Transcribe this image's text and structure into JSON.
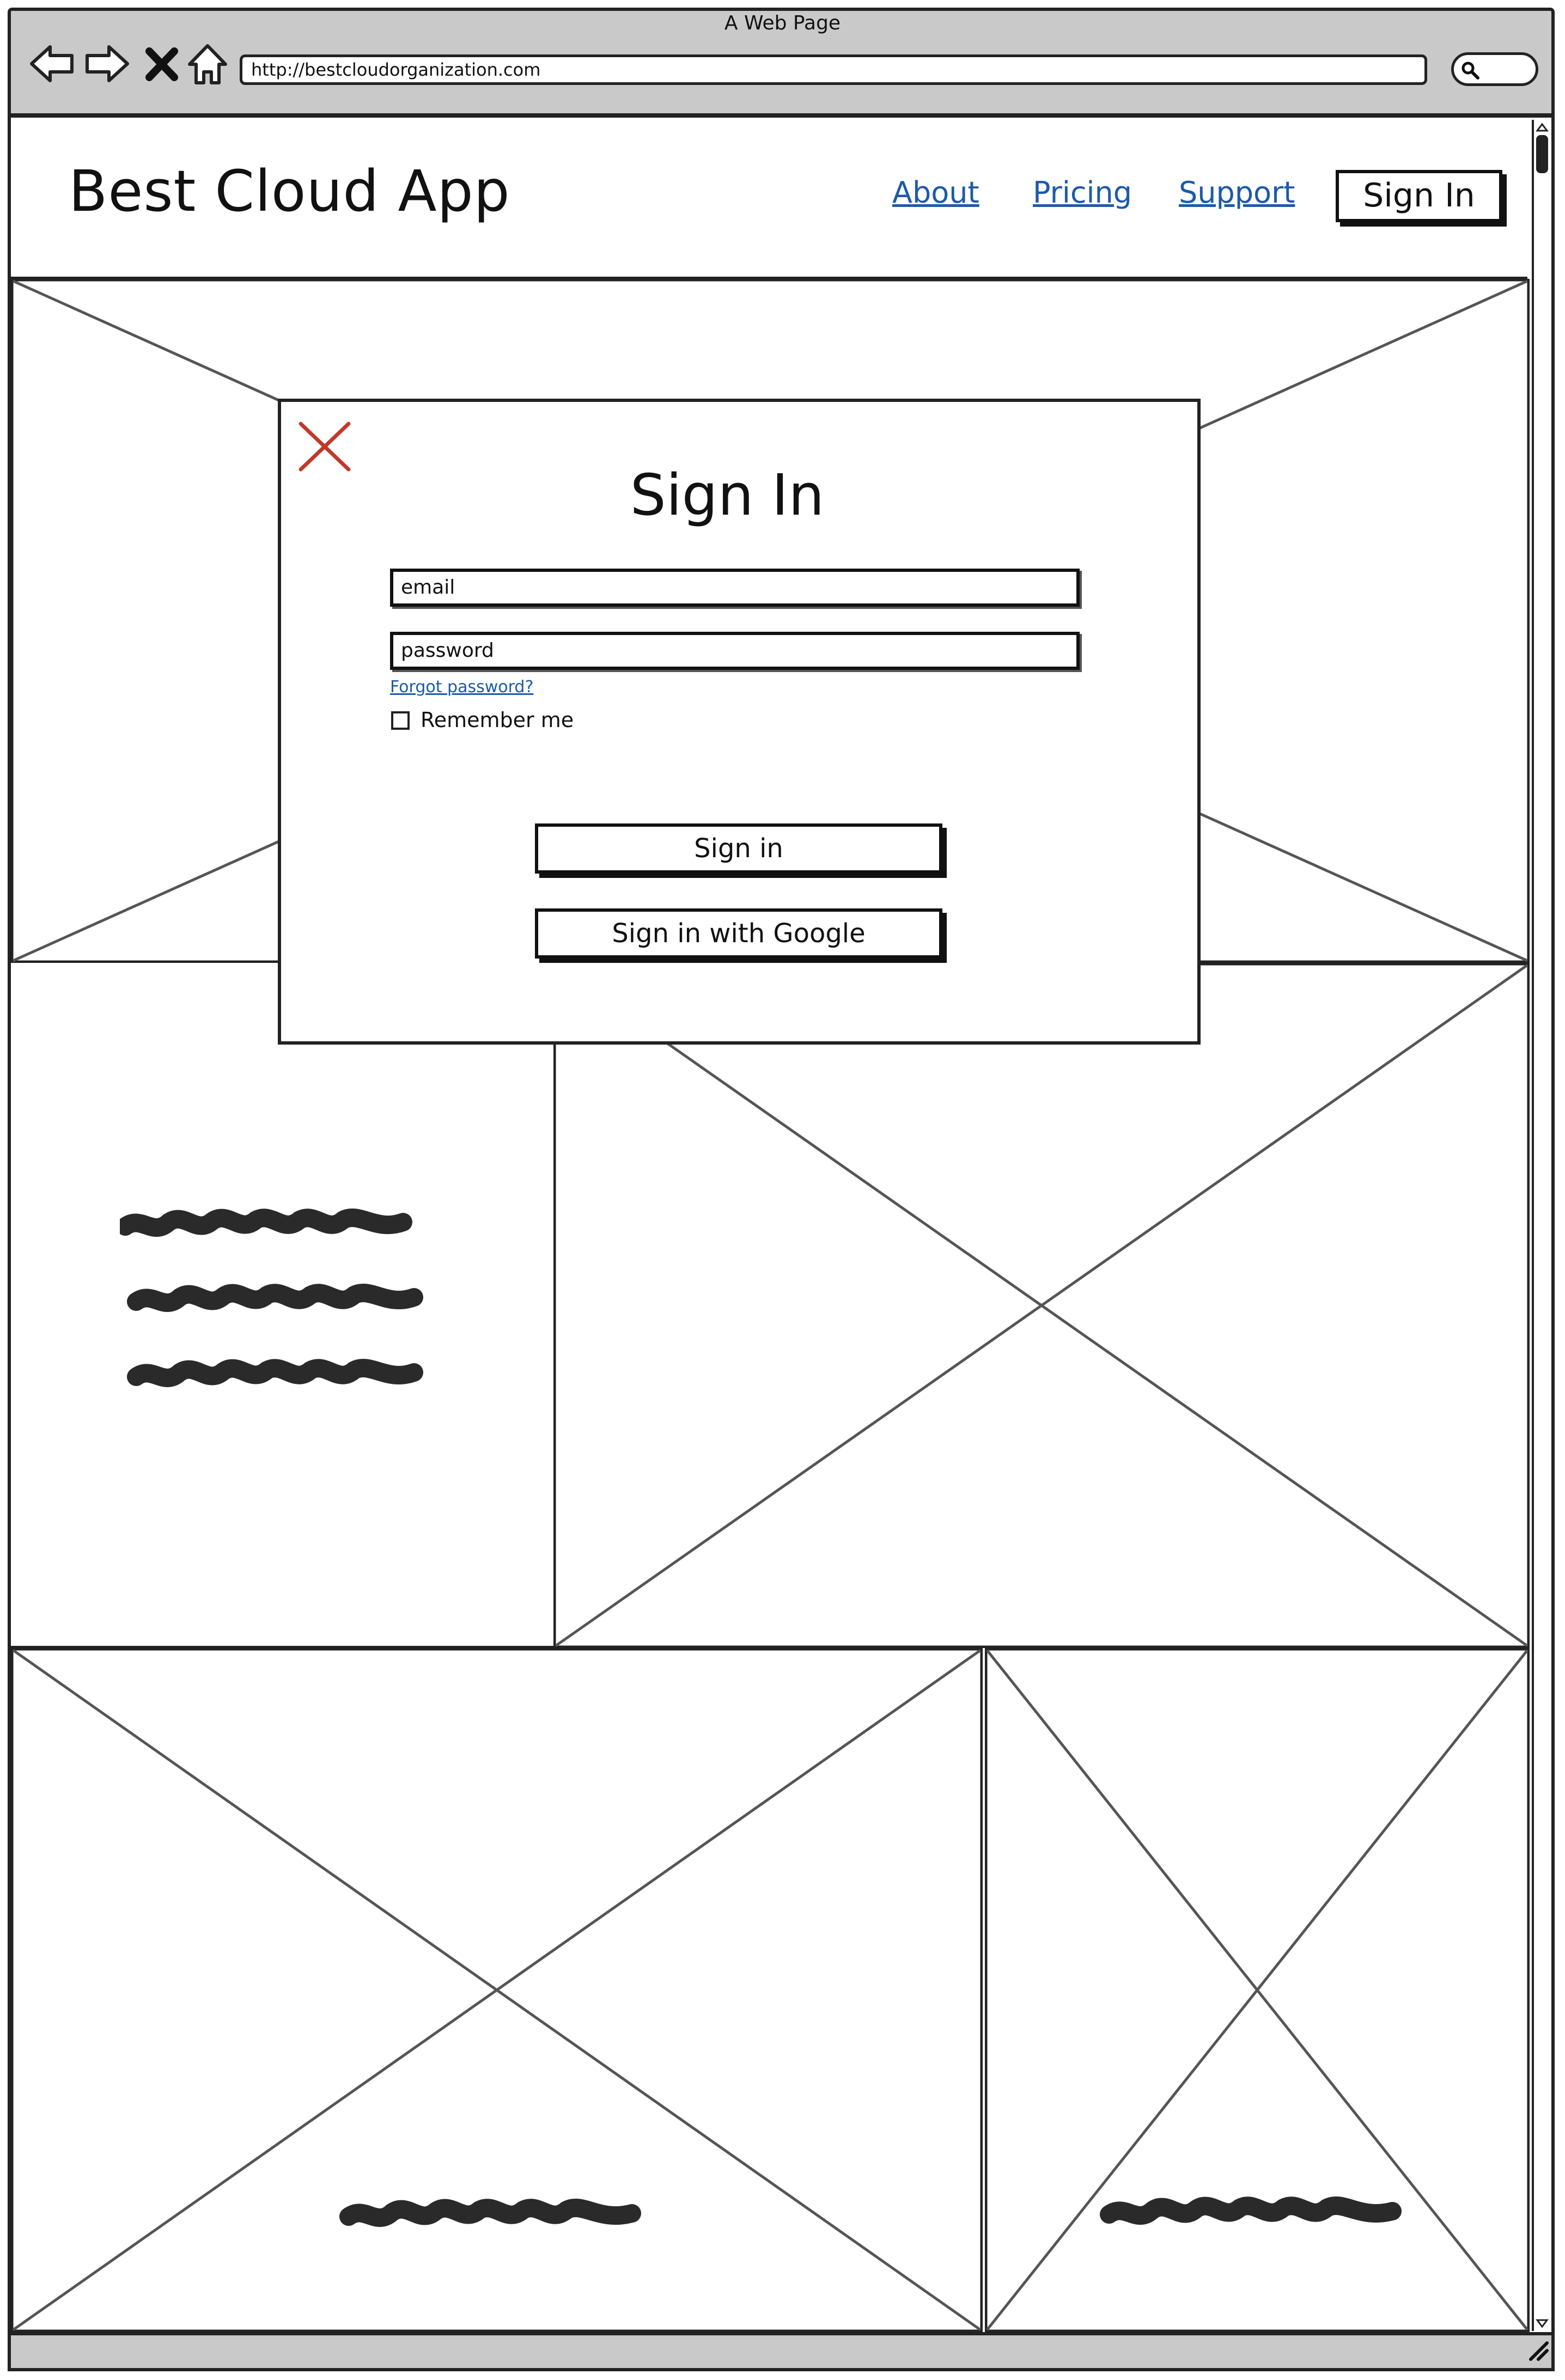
{
  "browser": {
    "window_title": "A Web Page",
    "url": "http://bestcloudorganization.com"
  },
  "header": {
    "site_title": "Best Cloud App",
    "nav": [
      "About",
      "Pricing",
      "Support"
    ],
    "signin_label": "Sign In"
  },
  "modal": {
    "title": "Sign In",
    "email_placeholder": "email",
    "password_placeholder": "password",
    "forgot_label": "Forgot password?",
    "remember_label": "Remember me",
    "remember_checked": false,
    "signin_button": "Sign in",
    "google_button": "Sign in with Google",
    "close_icon": "close-x-icon",
    "close_icon_color": "#c0392b"
  },
  "icons": {
    "back": "back-arrow-icon",
    "forward": "forward-arrow-icon",
    "stop": "stop-x-icon",
    "home": "home-icon",
    "search": "search-icon",
    "resize": "resize-grip-icon"
  },
  "colors": {
    "chrome": "#c9c9c9",
    "link": "#1d5aa8",
    "stroke": "#222222"
  }
}
